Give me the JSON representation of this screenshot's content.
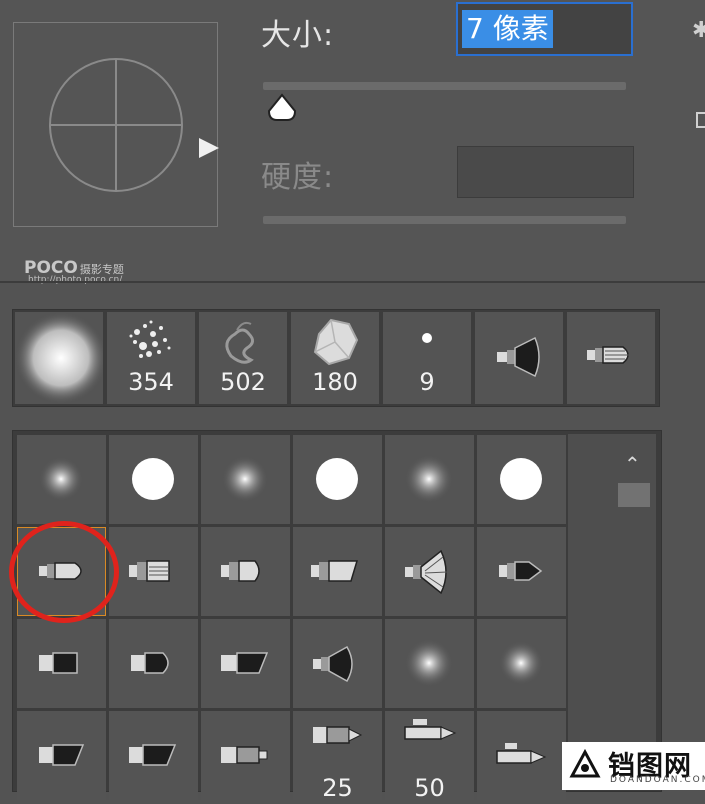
{
  "size": {
    "label": "大小:",
    "value": "7 像素",
    "slider_value": 0.02
  },
  "hardness": {
    "label": "硬度:",
    "value": ""
  },
  "watermark": {
    "brand": "POCO",
    "tag": "摄影专题",
    "url": "http://photo.poco.cn/"
  },
  "recent_brushes": [
    {
      "icon": "soft-round-brush-icon",
      "size": ""
    },
    {
      "icon": "spatter-brush-icon",
      "size": "354"
    },
    {
      "icon": "smoke-brush-icon",
      "size": "502"
    },
    {
      "icon": "crystal-brush-icon",
      "size": "180"
    },
    {
      "icon": "hard-round-brush-icon",
      "size": "9"
    },
    {
      "icon": "fan-brush-icon",
      "size": ""
    },
    {
      "icon": "pointed-brush-icon",
      "size": ""
    }
  ],
  "preset_sizes": [
    "25",
    "50"
  ],
  "site_logo": {
    "name": "铛图网",
    "domain": "DOANDOAN.COM"
  },
  "colors": {
    "selection": "#3a8ee6",
    "highlight": "#e0231c",
    "selected_border": "#d98a25"
  }
}
